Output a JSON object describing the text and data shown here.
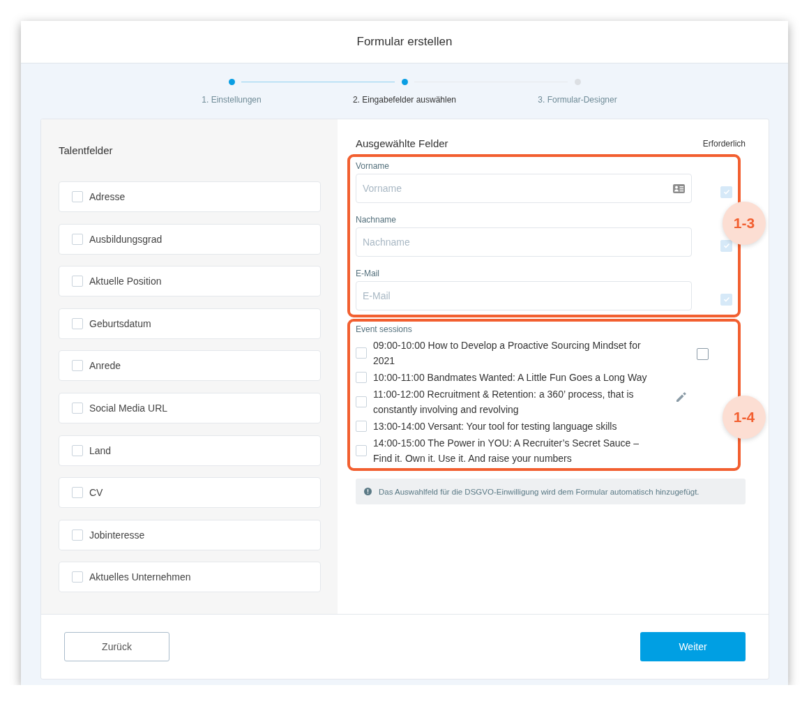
{
  "window": {
    "title": "Formular erstellen"
  },
  "steps": [
    {
      "label": "1. Einstellungen",
      "selected": false
    },
    {
      "label": "2. Eingabefelder auswählen",
      "selected": true
    },
    {
      "label": "3. Formular-Designer",
      "selected": false
    }
  ],
  "talent_fields": {
    "title": "Talentfelder",
    "items": [
      {
        "label": "Adresse",
        "checked": false
      },
      {
        "label": "Ausbildungsgrad",
        "checked": false
      },
      {
        "label": "Aktuelle Position",
        "checked": false
      },
      {
        "label": "Geburtsdatum",
        "checked": false
      },
      {
        "label": "Anrede",
        "checked": false
      },
      {
        "label": "Social Media URL",
        "checked": false
      },
      {
        "label": "Land",
        "checked": false
      },
      {
        "label": "CV",
        "checked": false
      },
      {
        "label": "Jobinteresse",
        "checked": false
      },
      {
        "label": "Aktuelles Unternehmen",
        "checked": false
      }
    ]
  },
  "selected_fields": {
    "title": "Ausgewählte Felder",
    "required_heading": "Erforderlich",
    "groups": [
      {
        "kind": "inputs",
        "badge": "1-3",
        "fields": [
          {
            "label": "Vorname",
            "placeholder": "Vorname",
            "contact_icon": true,
            "required": true
          },
          {
            "label": "Nachname",
            "placeholder": "Nachname",
            "contact_icon": false,
            "required": true
          },
          {
            "label": "E-Mail",
            "placeholder": "E-Mail",
            "contact_icon": false,
            "required": true
          }
        ]
      },
      {
        "kind": "checklist",
        "badge": "1-4",
        "label": "Event sessions",
        "required": false,
        "options": [
          {
            "text": "09:00-10:00 How to Develop a Proactive Sourcing Mindset for 2021",
            "checked": false
          },
          {
            "text": "10:00-11:00 Bandmates Wanted: A Little Fun Goes a Long Way",
            "checked": false
          },
          {
            "text": "11:00-12:00 Recruitment & Retention: a 360’ process, that is constantly involving and revolving",
            "checked": false
          },
          {
            "text": "13:00-14:00 Versant: Your tool for testing language skills",
            "checked": false
          },
          {
            "text": "14:00-15:00 The Power in YOU: A Recruiter’s Secret Sauce – Find it. Own it. Use it. And raise your numbers",
            "checked": false
          }
        ]
      }
    ],
    "info_note": "Das Auswahlfeld für die DSGVO-Einwilligung wird dem Formular automatisch hinzugefügt."
  },
  "footer": {
    "back_button": "Zurück",
    "next_button": "Weiter"
  }
}
